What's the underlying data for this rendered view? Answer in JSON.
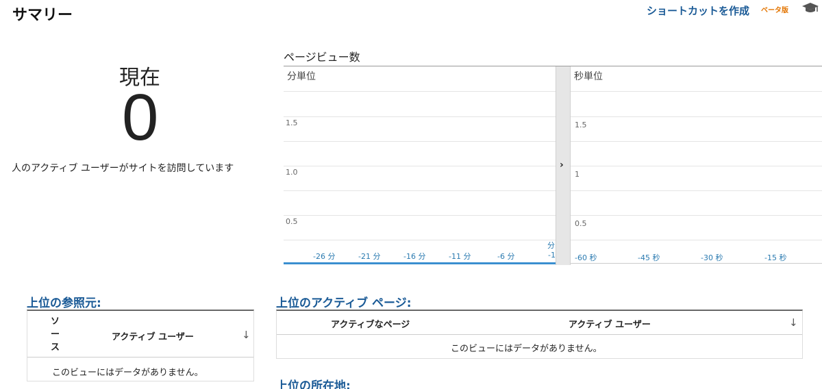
{
  "header": {
    "title": "サマリー",
    "shortcut_label": "ショートカットを作成",
    "beta_label": "ベータ版"
  },
  "realtime": {
    "now_label": "現在",
    "active_count": "0",
    "description": "人のアクティブ ユーザーがサイトを訪問しています"
  },
  "pageviews": {
    "title": "ページビュー数",
    "minute_panel": {
      "label": "分単位",
      "y_ticks": [
        "1.5",
        "1.0",
        "0.5"
      ],
      "x_ticks": [
        "-26 分",
        "-21 分",
        "-16 分",
        "-11 分",
        "-6 分"
      ],
      "x_last_top": "分",
      "x_last_bottom": "-1"
    },
    "second_panel": {
      "label": "秒単位",
      "y_ticks": [
        "1.5",
        "1",
        "0.5"
      ],
      "x_ticks": [
        "-60 秒",
        "-45 秒",
        "-30 秒",
        "-15 秒"
      ]
    },
    "toggle_arrow": "›"
  },
  "referrers": {
    "title": "上位の参照元:",
    "col_source": "ソース",
    "col_users": "アクティブ ユーザー",
    "empty": "このビューにはデータがありません。"
  },
  "active_pages": {
    "title": "上位のアクティブ ページ:",
    "col_page": "アクティブなページ",
    "col_users": "アクティブ ユーザー",
    "empty": "このビューにはデータがありません。"
  },
  "locations": {
    "title": "上位の所在地:"
  },
  "sort_icon": "↓"
}
